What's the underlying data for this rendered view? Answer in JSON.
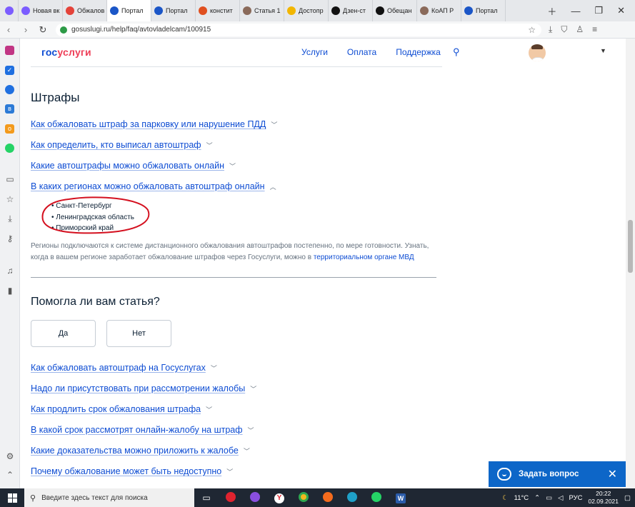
{
  "browser": {
    "tabs": [
      {
        "label": "Новая вк",
        "color": "#7b5cff"
      },
      {
        "label": "Обжалов",
        "color": "#e4433a"
      },
      {
        "label": "Портал",
        "color": "#1b56c7",
        "active": true
      },
      {
        "label": "Портал",
        "color": "#1b56c7"
      },
      {
        "label": "констит",
        "color": "#e05020"
      },
      {
        "label": "Статья 1",
        "color": "#8a6a5a"
      },
      {
        "label": "Достопр",
        "color": "#f2b600"
      },
      {
        "label": "Дзен-ст",
        "color": "#111111"
      },
      {
        "label": "Обещан",
        "color": "#111111"
      },
      {
        "label": "КоАП Р",
        "color": "#8a6a5a"
      },
      {
        "label": "Портал",
        "color": "#1b56c7"
      }
    ],
    "url": "gosuslugi.ru/help/faq/avtovladelcam/100915"
  },
  "header": {
    "logo_part1": "гос",
    "logo_part2": "услуги",
    "nav": [
      "Услуги",
      "Оплата",
      "Поддержка"
    ]
  },
  "content": {
    "section_title": "Штрафы",
    "faq_top": [
      "Как обжаловать штраф за парковку или нарушение ПДД",
      "Как определить, кто выписал автоштраф",
      "Какие автоштрафы можно обжаловать онлайн",
      "В каких регионах можно обжаловать автоштраф онлайн"
    ],
    "regions": [
      "Санкт-Петербург",
      "Ленинградская область",
      "Приморский край"
    ],
    "info_text": "Регионы подключаются к системе дистанционного обжалования автоштрафов постепенно, по мере готовности. Узнать, когда в вашем регионе заработает обжалование штрафов через Госуслуги, можно в ",
    "info_link": "территориальном органе МВД",
    "helpful_title": "Помогла ли вам статья?",
    "yes_label": "Да",
    "no_label": "Нет",
    "faq_bottom": [
      "Как обжаловать автоштраф на Госуслугах",
      "Надо ли присутствовать при рассмотрении жалобы",
      "Как продлить срок обжалования штрафа",
      "В какой срок рассмотрят онлайн-жалобу на штраф",
      "Какие доказательства можно приложить к жалобе",
      "Почему обжалование может быть недоступно"
    ]
  },
  "ask_widget": {
    "label": "Задать вопрос"
  },
  "taskbar": {
    "search_placeholder": "Введите здесь текст для поиска",
    "temperature": "11°C",
    "language": "РУС",
    "time": "20:22",
    "date": "02.09.2021"
  }
}
